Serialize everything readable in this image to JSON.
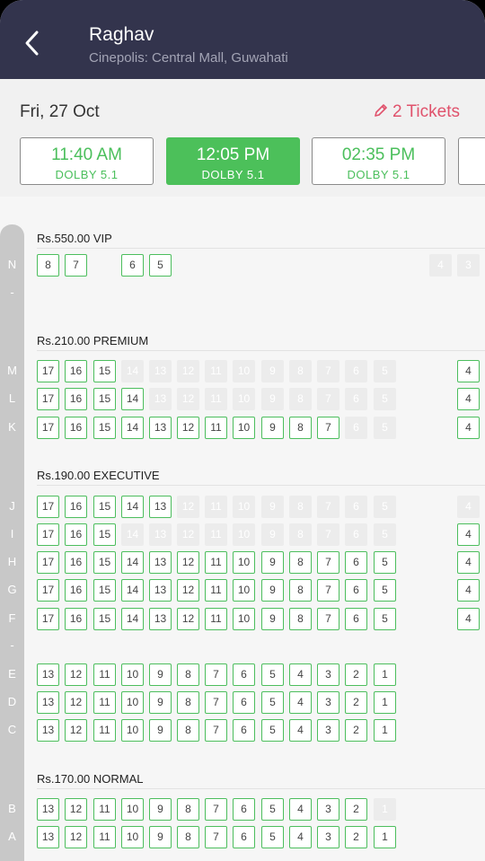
{
  "header": {
    "title": "Raghav",
    "subtitle": "Cinepolis: Central Mall, Guwahati"
  },
  "date_label": "Fri, 27 Oct",
  "tickets_label": "2 Tickets",
  "colors": {
    "header_bg": "#33344d",
    "available": "#4cbe5d",
    "selected_time": "#4cc05a",
    "tickets_accent": "#e0526c",
    "sold": "#ececec"
  },
  "showtimes": [
    {
      "time": "11:40 AM",
      "format": "DOLBY 5.1",
      "selected": false
    },
    {
      "time": "12:05 PM",
      "format": "DOLBY 5.1",
      "selected": true
    },
    {
      "time": "02:35 PM",
      "format": "DOLBY 5.1",
      "selected": false
    }
  ],
  "sections": [
    {
      "label": "Rs.550.00  VIP"
    },
    {
      "label": "Rs.210.00  PREMIUM"
    },
    {
      "label": "Rs.190.00  EXECUTIVE"
    },
    {
      "label": "Rs.170.00  NORMAL"
    }
  ],
  "row_labels": [
    "N",
    "-",
    "M",
    "L",
    "K",
    "J",
    "I",
    "H",
    "G",
    "F",
    "-",
    "E",
    "D",
    "C",
    "B",
    "A"
  ],
  "seat_rows": [
    {
      "row": "N",
      "seats": [
        {
          "n": "8",
          "sold": false
        },
        {
          "n": "7",
          "sold": false
        },
        {
          "n": "",
          "gap": true
        },
        {
          "n": "6",
          "sold": false
        },
        {
          "n": "5",
          "sold": false
        },
        {
          "n": "",
          "gap": true
        },
        {
          "n": "",
          "gap": true
        },
        {
          "n": "",
          "gap": true
        },
        {
          "n": "",
          "gap": true
        },
        {
          "n": "",
          "gap": true
        },
        {
          "n": "",
          "gap": true
        },
        {
          "n": "",
          "gap": true
        },
        {
          "n": "",
          "gap": true
        },
        {
          "n": "",
          "gap": true
        },
        {
          "n": "4",
          "sold": true
        },
        {
          "n": "3",
          "sold": true
        }
      ]
    },
    {
      "row": "M",
      "seats": [
        {
          "n": "17",
          "sold": false
        },
        {
          "n": "16",
          "sold": false
        },
        {
          "n": "15",
          "sold": false
        },
        {
          "n": "14",
          "sold": true
        },
        {
          "n": "13",
          "sold": true
        },
        {
          "n": "12",
          "sold": true
        },
        {
          "n": "11",
          "sold": true
        },
        {
          "n": "10",
          "sold": true
        },
        {
          "n": "9",
          "sold": true
        },
        {
          "n": "8",
          "sold": true
        },
        {
          "n": "7",
          "sold": true
        },
        {
          "n": "6",
          "sold": true
        },
        {
          "n": "5",
          "sold": true
        },
        {
          "n": "",
          "gap": true
        },
        {
          "n": "",
          "gap": true
        },
        {
          "n": "4",
          "sold": false
        }
      ]
    },
    {
      "row": "L",
      "seats": [
        {
          "n": "17",
          "sold": false
        },
        {
          "n": "16",
          "sold": false
        },
        {
          "n": "15",
          "sold": false
        },
        {
          "n": "14",
          "sold": false
        },
        {
          "n": "13",
          "sold": true
        },
        {
          "n": "12",
          "sold": true
        },
        {
          "n": "11",
          "sold": true
        },
        {
          "n": "10",
          "sold": true
        },
        {
          "n": "9",
          "sold": true
        },
        {
          "n": "8",
          "sold": true
        },
        {
          "n": "7",
          "sold": true
        },
        {
          "n": "6",
          "sold": true
        },
        {
          "n": "5",
          "sold": true
        },
        {
          "n": "",
          "gap": true
        },
        {
          "n": "",
          "gap": true
        },
        {
          "n": "4",
          "sold": false
        }
      ]
    },
    {
      "row": "K",
      "seats": [
        {
          "n": "17",
          "sold": false
        },
        {
          "n": "16",
          "sold": false
        },
        {
          "n": "15",
          "sold": false
        },
        {
          "n": "14",
          "sold": false
        },
        {
          "n": "13",
          "sold": false
        },
        {
          "n": "12",
          "sold": false
        },
        {
          "n": "11",
          "sold": false
        },
        {
          "n": "10",
          "sold": false
        },
        {
          "n": "9",
          "sold": false
        },
        {
          "n": "8",
          "sold": false
        },
        {
          "n": "7",
          "sold": false
        },
        {
          "n": "6",
          "sold": true
        },
        {
          "n": "5",
          "sold": true
        },
        {
          "n": "",
          "gap": true
        },
        {
          "n": "",
          "gap": true
        },
        {
          "n": "4",
          "sold": false
        }
      ]
    },
    {
      "row": "J",
      "seats": [
        {
          "n": "17",
          "sold": false
        },
        {
          "n": "16",
          "sold": false
        },
        {
          "n": "15",
          "sold": false
        },
        {
          "n": "14",
          "sold": false
        },
        {
          "n": "13",
          "sold": false
        },
        {
          "n": "12",
          "sold": true
        },
        {
          "n": "11",
          "sold": true
        },
        {
          "n": "10",
          "sold": true
        },
        {
          "n": "9",
          "sold": true
        },
        {
          "n": "8",
          "sold": true
        },
        {
          "n": "7",
          "sold": true
        },
        {
          "n": "6",
          "sold": true
        },
        {
          "n": "5",
          "sold": true
        },
        {
          "n": "",
          "gap": true
        },
        {
          "n": "",
          "gap": true
        },
        {
          "n": "4",
          "sold": true
        }
      ]
    },
    {
      "row": "I",
      "seats": [
        {
          "n": "17",
          "sold": false
        },
        {
          "n": "16",
          "sold": false
        },
        {
          "n": "15",
          "sold": false
        },
        {
          "n": "14",
          "sold": true
        },
        {
          "n": "13",
          "sold": true
        },
        {
          "n": "12",
          "sold": true
        },
        {
          "n": "11",
          "sold": true
        },
        {
          "n": "10",
          "sold": true
        },
        {
          "n": "9",
          "sold": true
        },
        {
          "n": "8",
          "sold": true
        },
        {
          "n": "7",
          "sold": true
        },
        {
          "n": "6",
          "sold": true
        },
        {
          "n": "5",
          "sold": true
        },
        {
          "n": "",
          "gap": true
        },
        {
          "n": "",
          "gap": true
        },
        {
          "n": "4",
          "sold": false
        }
      ]
    },
    {
      "row": "H",
      "seats": [
        {
          "n": "17",
          "sold": false
        },
        {
          "n": "16",
          "sold": false
        },
        {
          "n": "15",
          "sold": false
        },
        {
          "n": "14",
          "sold": false
        },
        {
          "n": "13",
          "sold": false
        },
        {
          "n": "12",
          "sold": false
        },
        {
          "n": "11",
          "sold": false
        },
        {
          "n": "10",
          "sold": false
        },
        {
          "n": "9",
          "sold": false
        },
        {
          "n": "8",
          "sold": false
        },
        {
          "n": "7",
          "sold": false
        },
        {
          "n": "6",
          "sold": false
        },
        {
          "n": "5",
          "sold": false
        },
        {
          "n": "",
          "gap": true
        },
        {
          "n": "",
          "gap": true
        },
        {
          "n": "4",
          "sold": false
        }
      ]
    },
    {
      "row": "G",
      "seats": [
        {
          "n": "17",
          "sold": false
        },
        {
          "n": "16",
          "sold": false
        },
        {
          "n": "15",
          "sold": false
        },
        {
          "n": "14",
          "sold": false
        },
        {
          "n": "13",
          "sold": false
        },
        {
          "n": "12",
          "sold": false
        },
        {
          "n": "11",
          "sold": false
        },
        {
          "n": "10",
          "sold": false
        },
        {
          "n": "9",
          "sold": false
        },
        {
          "n": "8",
          "sold": false
        },
        {
          "n": "7",
          "sold": false
        },
        {
          "n": "6",
          "sold": false
        },
        {
          "n": "5",
          "sold": false
        },
        {
          "n": "",
          "gap": true
        },
        {
          "n": "",
          "gap": true
        },
        {
          "n": "4",
          "sold": false
        }
      ]
    },
    {
      "row": "F",
      "seats": [
        {
          "n": "17",
          "sold": false
        },
        {
          "n": "16",
          "sold": false
        },
        {
          "n": "15",
          "sold": false
        },
        {
          "n": "14",
          "sold": false
        },
        {
          "n": "13",
          "sold": false
        },
        {
          "n": "12",
          "sold": false
        },
        {
          "n": "11",
          "sold": false
        },
        {
          "n": "10",
          "sold": false
        },
        {
          "n": "9",
          "sold": false
        },
        {
          "n": "8",
          "sold": false
        },
        {
          "n": "7",
          "sold": false
        },
        {
          "n": "6",
          "sold": false
        },
        {
          "n": "5",
          "sold": false
        },
        {
          "n": "",
          "gap": true
        },
        {
          "n": "",
          "gap": true
        },
        {
          "n": "4",
          "sold": false
        }
      ]
    },
    {
      "row": "E",
      "seats": [
        {
          "n": "13",
          "sold": false
        },
        {
          "n": "12",
          "sold": false
        },
        {
          "n": "11",
          "sold": false
        },
        {
          "n": "10",
          "sold": false
        },
        {
          "n": "9",
          "sold": false
        },
        {
          "n": "8",
          "sold": false
        },
        {
          "n": "7",
          "sold": false
        },
        {
          "n": "6",
          "sold": false
        },
        {
          "n": "5",
          "sold": false
        },
        {
          "n": "4",
          "sold": false
        },
        {
          "n": "3",
          "sold": false
        },
        {
          "n": "2",
          "sold": false
        },
        {
          "n": "1",
          "sold": false
        }
      ]
    },
    {
      "row": "D",
      "seats": [
        {
          "n": "13",
          "sold": false
        },
        {
          "n": "12",
          "sold": false
        },
        {
          "n": "11",
          "sold": false
        },
        {
          "n": "10",
          "sold": false
        },
        {
          "n": "9",
          "sold": false
        },
        {
          "n": "8",
          "sold": false
        },
        {
          "n": "7",
          "sold": false
        },
        {
          "n": "6",
          "sold": false
        },
        {
          "n": "5",
          "sold": false
        },
        {
          "n": "4",
          "sold": false
        },
        {
          "n": "3",
          "sold": false
        },
        {
          "n": "2",
          "sold": false
        },
        {
          "n": "1",
          "sold": false
        }
      ]
    },
    {
      "row": "C",
      "seats": [
        {
          "n": "13",
          "sold": false
        },
        {
          "n": "12",
          "sold": false
        },
        {
          "n": "11",
          "sold": false
        },
        {
          "n": "10",
          "sold": false
        },
        {
          "n": "9",
          "sold": false
        },
        {
          "n": "8",
          "sold": false
        },
        {
          "n": "7",
          "sold": false
        },
        {
          "n": "6",
          "sold": false
        },
        {
          "n": "5",
          "sold": false
        },
        {
          "n": "4",
          "sold": false
        },
        {
          "n": "3",
          "sold": false
        },
        {
          "n": "2",
          "sold": false
        },
        {
          "n": "1",
          "sold": false
        }
      ]
    },
    {
      "row": "B",
      "seats": [
        {
          "n": "13",
          "sold": false
        },
        {
          "n": "12",
          "sold": false
        },
        {
          "n": "11",
          "sold": false
        },
        {
          "n": "10",
          "sold": false
        },
        {
          "n": "9",
          "sold": false
        },
        {
          "n": "8",
          "sold": false
        },
        {
          "n": "7",
          "sold": false
        },
        {
          "n": "6",
          "sold": false
        },
        {
          "n": "5",
          "sold": false
        },
        {
          "n": "4",
          "sold": false
        },
        {
          "n": "3",
          "sold": false
        },
        {
          "n": "2",
          "sold": false
        },
        {
          "n": "1",
          "sold": true
        }
      ]
    },
    {
      "row": "A",
      "seats": [
        {
          "n": "13",
          "sold": false
        },
        {
          "n": "12",
          "sold": false
        },
        {
          "n": "11",
          "sold": false
        },
        {
          "n": "10",
          "sold": false
        },
        {
          "n": "9",
          "sold": false
        },
        {
          "n": "8",
          "sold": false
        },
        {
          "n": "7",
          "sold": false
        },
        {
          "n": "6",
          "sold": false
        },
        {
          "n": "5",
          "sold": false
        },
        {
          "n": "4",
          "sold": false
        },
        {
          "n": "3",
          "sold": false
        },
        {
          "n": "2",
          "sold": false
        },
        {
          "n": "1",
          "sold": false
        }
      ]
    }
  ]
}
